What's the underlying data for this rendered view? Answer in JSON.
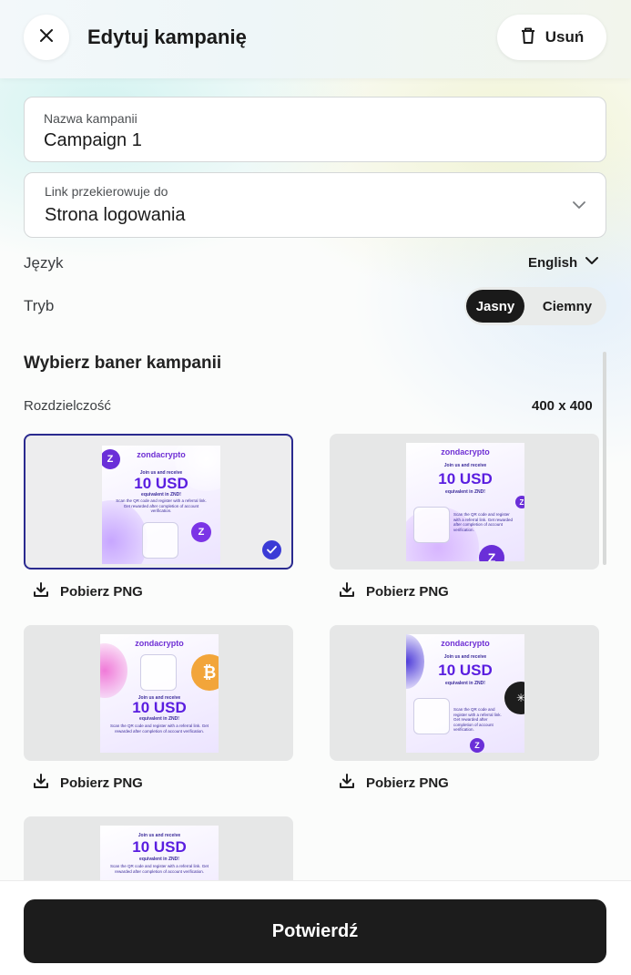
{
  "header": {
    "title": "Edytuj kampanię",
    "delete_label": "Usuń"
  },
  "form": {
    "campaign_name": {
      "label": "Nazwa kampanii",
      "value": "Campaign 1"
    },
    "redirect_link": {
      "label": "Link przekierowuje do",
      "value": "Strona logowania"
    },
    "language": {
      "label": "Język",
      "value": "English"
    },
    "mode": {
      "label": "Tryb",
      "options": [
        "Jasny",
        "Ciemny"
      ],
      "selected": "Jasny"
    }
  },
  "banners": {
    "title": "Wybierz baner kampanii",
    "resolution_label": "Rozdzielczość",
    "resolution_value": "400 x 400",
    "download_label": "Pobierz PNG",
    "selected_index": 0,
    "content": {
      "logo": "zondacrypto",
      "join": "Join us and receive",
      "amount": "10 USD",
      "equiv": "equivalent in ZND!",
      "desc": "Scan the QR code and register with a referral link. Get rewarded after completion of account verification."
    }
  },
  "footer": {
    "confirm_label": "Potwierdź"
  },
  "colors": {
    "accent": "#1c1c1c",
    "selection": "#2a2a8f",
    "check": "#3b3bd6",
    "brand": "#6e2fd4"
  }
}
